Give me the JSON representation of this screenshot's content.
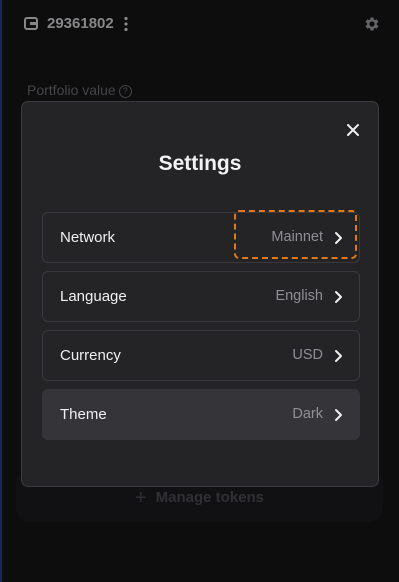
{
  "header": {
    "account_id": "29361802",
    "icons": {
      "wallet": "wallet-icon",
      "menu": "kebab-menu-icon",
      "settings": "gear-icon"
    }
  },
  "portfolio": {
    "label": "Portfolio value"
  },
  "background_actions": {
    "manage_tokens_label": "Manage tokens"
  },
  "modal": {
    "title": "Settings",
    "close_icon": "close-icon",
    "rows": [
      {
        "label": "Network",
        "value": "Mainnet",
        "selected": false,
        "focused": true
      },
      {
        "label": "Language",
        "value": "English",
        "selected": false,
        "focused": false
      },
      {
        "label": "Currency",
        "value": "USD",
        "selected": false,
        "focused": false
      },
      {
        "label": "Theme",
        "value": "Dark",
        "selected": true,
        "focused": false
      }
    ]
  },
  "colors": {
    "focus_accent": "#e07a17",
    "modal_bg": "#242427",
    "page_bg": "#141416"
  }
}
